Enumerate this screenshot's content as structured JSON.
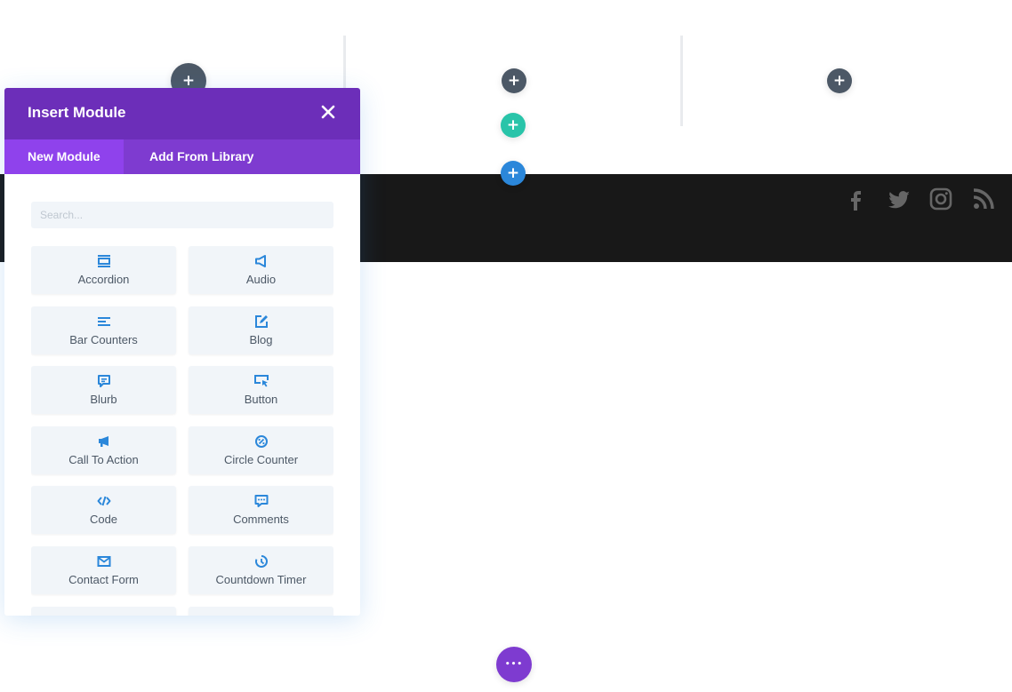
{
  "page": {
    "add_glyph": "+",
    "more_glyph": "•••"
  },
  "modal": {
    "title": "Insert Module",
    "tabs": [
      {
        "label": "New Module",
        "active": true
      },
      {
        "label": "Add From Library",
        "active": false
      }
    ],
    "search_placeholder": "Search...",
    "modules": [
      {
        "label": "Accordion",
        "icon": "accordion-icon"
      },
      {
        "label": "Audio",
        "icon": "audio-icon"
      },
      {
        "label": "Bar Counters",
        "icon": "bar-counters-icon"
      },
      {
        "label": "Blog",
        "icon": "blog-icon"
      },
      {
        "label": "Blurb",
        "icon": "blurb-icon"
      },
      {
        "label": "Button",
        "icon": "button-icon"
      },
      {
        "label": "Call To Action",
        "icon": "call-to-action-icon"
      },
      {
        "label": "Circle Counter",
        "icon": "circle-counter-icon"
      },
      {
        "label": "Code",
        "icon": "code-icon"
      },
      {
        "label": "Comments",
        "icon": "comments-icon"
      },
      {
        "label": "Contact Form",
        "icon": "contact-form-icon"
      },
      {
        "label": "Countdown Timer",
        "icon": "countdown-timer-icon"
      }
    ]
  },
  "social_icons": [
    "facebook-icon",
    "twitter-icon",
    "instagram-icon",
    "rss-icon"
  ],
  "colors": {
    "modal_header": "#6c2eb9",
    "tabs_bar": "#7e3bd0",
    "active_tab": "#8f42ec",
    "module_icon": "#2b87da",
    "column_add": "#4c5866",
    "row_add": "#29c4a9",
    "section_add": "#2b87da",
    "page_settings": "#7e3bd0",
    "footer_bar": "#181818",
    "social_icon": "#666666"
  }
}
